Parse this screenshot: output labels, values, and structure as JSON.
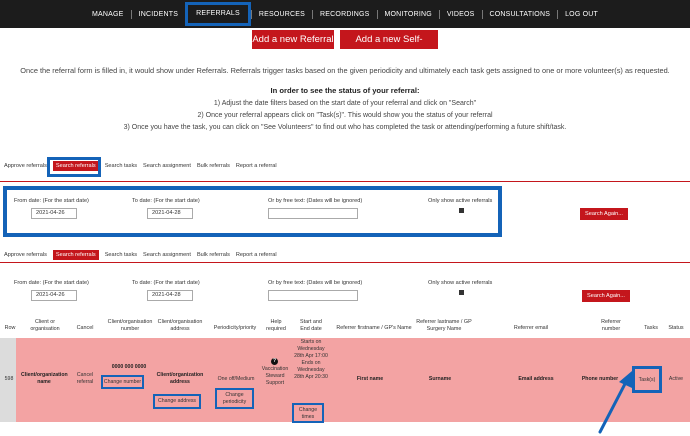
{
  "nav": {
    "items": [
      "MANAGE",
      "INCIDENTS",
      "REFERRALS",
      "RESOURCES",
      "RECORDINGS",
      "MONITORING",
      "VIDEOS",
      "CONSULTATIONS",
      "LOG OUT"
    ],
    "active_index": 2
  },
  "actions": {
    "add_referral": "Add a new Referral",
    "add_self_referral": "Add a new Self-Referral"
  },
  "intro": "Once the referral form is filled in, it would show under Referrals. Referrals trigger tasks based on the given periodicity and ultimately each task gets assigned to one or more volunteer(s) as requested.",
  "howto": {
    "title": "In order to see the status of your referral:",
    "steps": [
      "1) Adjust the date filters based on the start date of your referral and click on \"Search\"",
      "2) Once your referral appears click on \"Task(s)\". This would show you the status of your referral",
      "3) Once you have the task, you can click on \"See Volunteers\" to find out who has completed the task or attending/performing a future shift/task."
    ]
  },
  "tabs_top": [
    "Approve referrals",
    "Search referrals",
    "Search tasks",
    "Search assignment",
    "Bulk referrals",
    "Report a referral"
  ],
  "tabs_bottom": [
    "Approve referrals",
    "Search referrals",
    "Search tasks",
    "Search assignment",
    "Bulk referrals",
    "Report a referral"
  ],
  "filters": {
    "from_label": "From date: (For the start date)",
    "from_value": "2021-04-26",
    "to_label": "To date: (For the start date)",
    "to_value": "2021-04-28",
    "free_text_label": "Or by free text: (Dates will be ignored)",
    "free_text_value": "",
    "active_label": "Only show active referrals",
    "search_again": "Search Again..."
  },
  "table": {
    "headers": [
      "Row",
      "Client or organisation",
      "Cancel",
      "Client/organisation number",
      "Client/organisation address",
      "Periodicity/priority",
      "Help required",
      "Start and End date",
      "Referrer firstname / GP's Name",
      "Referrer lastname / GP Surgery Name",
      "Referrer email",
      "Referrer number",
      "Tasks",
      "Status"
    ],
    "row": {
      "row_id": "598",
      "client": "Client/organization name",
      "cancel": "Cancel referral",
      "number": "0000 000 0000",
      "change_number": "Change number",
      "address": "Client/organization address",
      "change_address": "Change address",
      "periodicity": "One off/Medium",
      "change_periodicity": "Change periodicity",
      "help": "Vaccination Steward Support",
      "help_icon": "?",
      "dates": "Starts on Wednesday 28th Apr 17:00 Ends on Wednesday 28th Apr 20:30",
      "change_dates": "Change times",
      "firstname": "First name",
      "lastname": "Surname",
      "email": "Email address",
      "phone": "Phone number",
      "tasks": "Task(s)",
      "status": "Active"
    }
  },
  "colors": {
    "nav_bg": "#1c1c1c",
    "accent_red": "#c4161c",
    "highlight_blue": "#1463b8",
    "row_pink": "#f3a3a3"
  },
  "icons": {
    "help": "question-circle-icon",
    "arrow": "annotation-arrow-icon"
  }
}
